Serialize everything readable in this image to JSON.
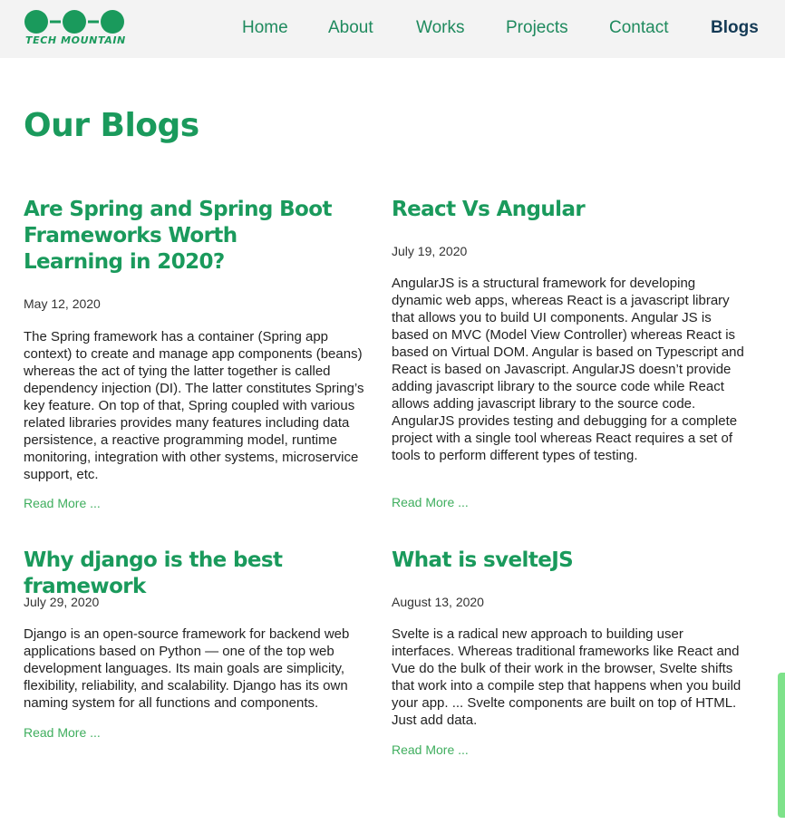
{
  "header": {
    "logo_text": "TECH MOUNTAIN",
    "nav": [
      {
        "label": "Home"
      },
      {
        "label": "About"
      },
      {
        "label": "Works"
      },
      {
        "label": "Projects"
      },
      {
        "label": "Contact"
      },
      {
        "label": "Blogs",
        "active": true
      }
    ]
  },
  "colors": {
    "brand_green": "#1a9a5c",
    "nav_active": "#143a55",
    "read_more": "#3fae5e",
    "header_bg": "#f3f3f3"
  },
  "page": {
    "title": "Our Blogs"
  },
  "blogs": [
    {
      "title": "Are Spring and Spring Boot Frameworks Worth Learning in 2020?",
      "date": "May 12, 2020",
      "excerpt": "The Spring framework has a container (Spring app context) to create and manage app components (beans) whereas the act of tying the latter together is called dependency injection (DI). The latter constitutes Spring’s key feature. On top of that, Spring coupled with various related libraries provides many features including data persistence, a reactive programming model, runtime monitoring, integration with other systems, microservice support, etc.",
      "read_more": "Read More ..."
    },
    {
      "title": "React Vs Angular",
      "date": "July 19, 2020",
      "excerpt": "AngularJS is a structural framework for developing dynamic web apps, whereas React is a javascript library that allows you to build UI components. Angular JS is based on MVC (Model View Controller) whereas React is based on Virtual DOM. Angular is based on Typescript and React is based on Javascript. AngularJS doesn’t provide adding javascript library to the source code while React allows adding javascript library to the source code. AngularJS provides testing and debugging for a complete project with a single tool whereas React requires a set of tools to perform different types of testing.",
      "read_more": "Read More ..."
    },
    {
      "title": "Why django is the best framework",
      "date": "July 29, 2020",
      "excerpt": "Django is an open-source framework for backend web applications based on Python — one of the top web development languages. Its main goals are simplicity, flexibility, reliability, and scalability. Django has its own naming system for all functions and components.",
      "read_more": "Read More ..."
    },
    {
      "title": "What is svelteJS",
      "date": "August 13, 2020",
      "excerpt": "Svelte is a radical new approach to building user interfaces. Whereas traditional frameworks like React and Vue do the bulk of their work in the browser, Svelte shifts that work into a compile step that happens when you build your app. ... Svelte components are built on top of HTML. Just add data.",
      "read_more": "Read More ..."
    }
  ]
}
